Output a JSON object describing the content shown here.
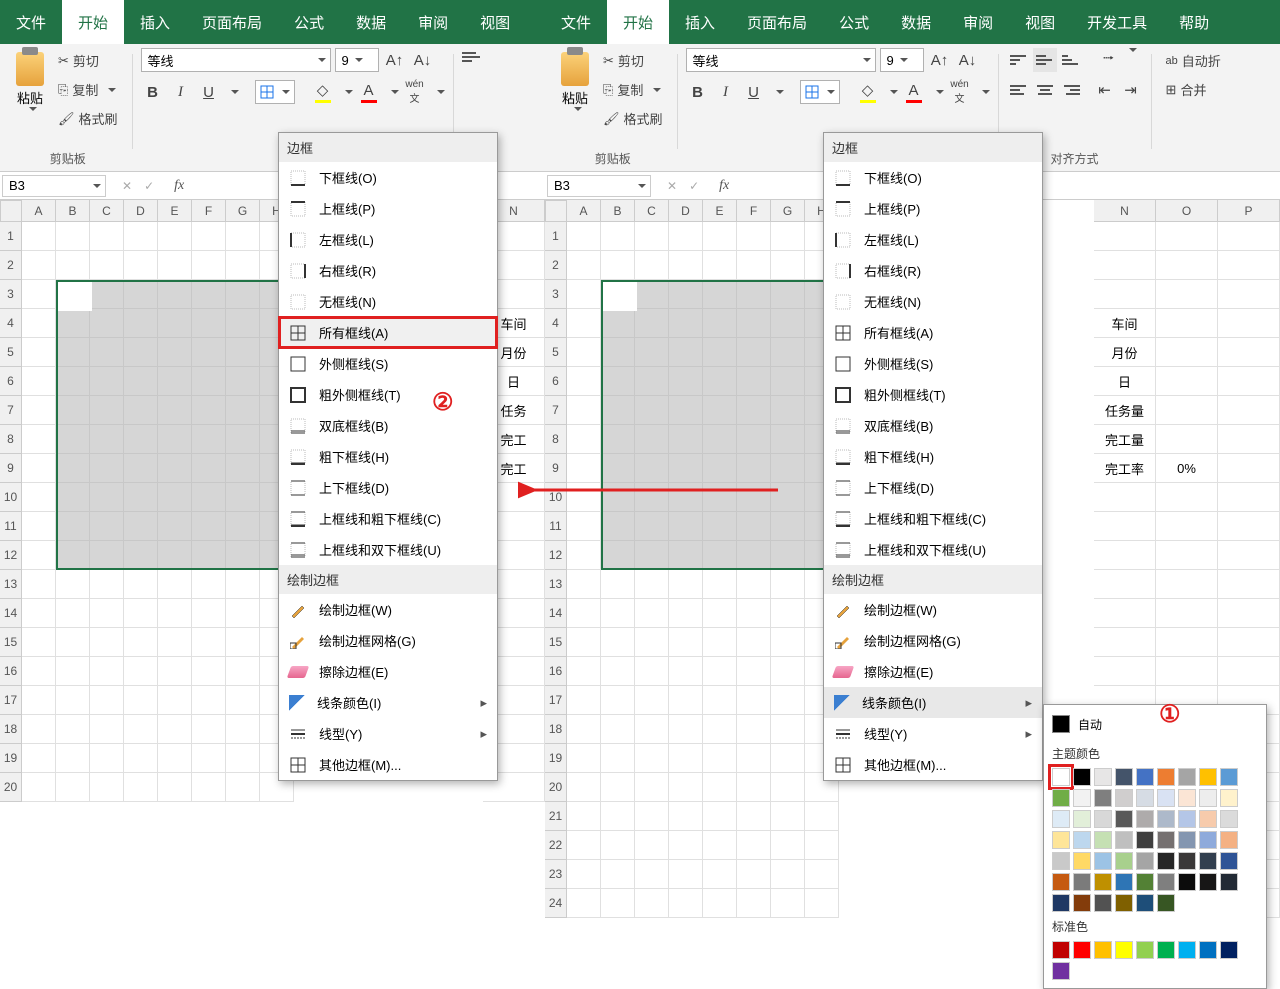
{
  "left": {
    "tabs": [
      "文件",
      "开始",
      "插入",
      "页面布局",
      "公式",
      "数据",
      "审阅",
      "视图"
    ],
    "tab_active": "开始",
    "clipboard": {
      "label": "剪贴板",
      "paste": "粘贴",
      "cut": "剪切",
      "copy": "复制",
      "format": "格式刷"
    },
    "font": {
      "name": "等线",
      "size": "9",
      "bold": "B",
      "italic": "I",
      "underline": "U"
    },
    "namebox": "B3",
    "cols": [
      "A",
      "B",
      "C",
      "D",
      "E",
      "F",
      "G",
      "H"
    ],
    "cols_far": [
      "N"
    ],
    "rows": 20,
    "data_col": [
      "",
      "",
      "",
      "车间",
      "月份",
      "日",
      "任务",
      "完工",
      "完工"
    ],
    "menu": {
      "hdr_border": "边框",
      "items_border": [
        {
          "t": "下框线(O)",
          "i": "bottom"
        },
        {
          "t": "上框线(P)",
          "i": "top"
        },
        {
          "t": "左框线(L)",
          "i": "left"
        },
        {
          "t": "右框线(R)",
          "i": "right"
        },
        {
          "t": "无框线(N)",
          "i": "none"
        },
        {
          "t": "所有框线(A)",
          "i": "all",
          "red": true
        },
        {
          "t": "外侧框线(S)",
          "i": "out"
        },
        {
          "t": "粗外侧框线(T)",
          "i": "outthick"
        },
        {
          "t": "双底框线(B)",
          "i": "dblbot"
        },
        {
          "t": "粗下框线(H)",
          "i": "thickbot"
        },
        {
          "t": "上下框线(D)",
          "i": "topbot"
        },
        {
          "t": "上框线和粗下框线(C)",
          "i": "topthickbot"
        },
        {
          "t": "上框线和双下框线(U)",
          "i": "topdblbot"
        }
      ],
      "hdr_draw": "绘制边框",
      "items_draw": [
        {
          "t": "绘制边框(W)",
          "i": "draw"
        },
        {
          "t": "绘制边框网格(G)",
          "i": "grid"
        },
        {
          "t": "擦除边框(E)",
          "i": "erase"
        },
        {
          "t": "线条颜色(I)",
          "i": "color",
          "sub": true
        },
        {
          "t": "线型(Y)",
          "i": "style",
          "sub": true
        },
        {
          "t": "其他边框(M)...",
          "i": "more"
        }
      ]
    },
    "circle": "②"
  },
  "right": {
    "tabs": [
      "文件",
      "开始",
      "插入",
      "页面布局",
      "公式",
      "数据",
      "审阅",
      "视图",
      "开发工具",
      "帮助"
    ],
    "tab_active": "开始",
    "clipboard": {
      "label": "剪贴板",
      "paste": "粘贴",
      "cut": "剪切",
      "copy": "复制",
      "format": "格式刷"
    },
    "font": {
      "name": "等线",
      "size": "9"
    },
    "align_label": "对齐方式",
    "auto_wrap": "自动折",
    "merge": "合并",
    "namebox": "B3",
    "cols": [
      "A",
      "B",
      "C",
      "D",
      "E",
      "F",
      "G",
      "H"
    ],
    "cols_far": [
      "N",
      "O",
      "P"
    ],
    "rows": 24,
    "data_col_N": [
      "",
      "",
      "",
      "车间",
      "月份",
      "日",
      "任务量",
      "完工量",
      "完工率"
    ],
    "data_col_O": [
      "",
      "",
      "",
      "",
      "",
      "",
      "",
      "",
      "0%"
    ],
    "menu": {
      "hdr_border": "边框",
      "items_border": [
        {
          "t": "下框线(O)",
          "i": "bottom"
        },
        {
          "t": "上框线(P)",
          "i": "top"
        },
        {
          "t": "左框线(L)",
          "i": "left"
        },
        {
          "t": "右框线(R)",
          "i": "right"
        },
        {
          "t": "无框线(N)",
          "i": "none"
        },
        {
          "t": "所有框线(A)",
          "i": "all"
        },
        {
          "t": "外侧框线(S)",
          "i": "out"
        },
        {
          "t": "粗外侧框线(T)",
          "i": "outthick"
        },
        {
          "t": "双底框线(B)",
          "i": "dblbot"
        },
        {
          "t": "粗下框线(H)",
          "i": "thickbot"
        },
        {
          "t": "上下框线(D)",
          "i": "topbot"
        },
        {
          "t": "上框线和粗下框线(C)",
          "i": "topthickbot"
        },
        {
          "t": "上框线和双下框线(U)",
          "i": "topdblbot"
        }
      ],
      "hdr_draw": "绘制边框",
      "items_draw": [
        {
          "t": "绘制边框(W)",
          "i": "draw"
        },
        {
          "t": "绘制边框网格(G)",
          "i": "grid"
        },
        {
          "t": "擦除边框(E)",
          "i": "erase"
        },
        {
          "t": "线条颜色(I)",
          "i": "color",
          "sub": true,
          "hov": true
        },
        {
          "t": "线型(Y)",
          "i": "style",
          "sub": true
        },
        {
          "t": "其他边框(M)...",
          "i": "more"
        }
      ]
    },
    "color_pop": {
      "auto": "自动",
      "theme": "主题颜色",
      "std": "标准色",
      "theme_colors": [
        [
          "#ffffff",
          "#000000",
          "#e7e6e6",
          "#44546a",
          "#4472c4",
          "#ed7d31",
          "#a5a5a5",
          "#ffc000",
          "#5b9bd5",
          "#70ad47"
        ],
        [
          "#f2f2f2",
          "#7f7f7f",
          "#d0cece",
          "#d6dce4",
          "#d9e2f3",
          "#fbe5d5",
          "#ededed",
          "#fff2cc",
          "#deebf6",
          "#e2efd9"
        ],
        [
          "#d8d8d8",
          "#595959",
          "#aeabab",
          "#adb9ca",
          "#b4c6e7",
          "#f7cbac",
          "#dbdbdb",
          "#fee599",
          "#bdd7ee",
          "#c5e0b3"
        ],
        [
          "#bfbfbf",
          "#3f3f3f",
          "#757070",
          "#8496b0",
          "#8eaadb",
          "#f4b183",
          "#c9c9c9",
          "#ffd965",
          "#9cc3e5",
          "#a8d08d"
        ],
        [
          "#a5a5a5",
          "#262626",
          "#3a3838",
          "#323f4f",
          "#2f5496",
          "#c55a11",
          "#7b7b7b",
          "#bf9000",
          "#2e75b5",
          "#538135"
        ],
        [
          "#7f7f7f",
          "#0c0c0c",
          "#171616",
          "#222a35",
          "#1f3864",
          "#833c0b",
          "#525252",
          "#7f6000",
          "#1e4e79",
          "#375623"
        ]
      ],
      "std_colors": [
        "#c00000",
        "#ff0000",
        "#ffc000",
        "#ffff00",
        "#92d050",
        "#00b050",
        "#00b0f0",
        "#0070c0",
        "#002060",
        "#7030a0"
      ]
    },
    "circle": "①"
  }
}
